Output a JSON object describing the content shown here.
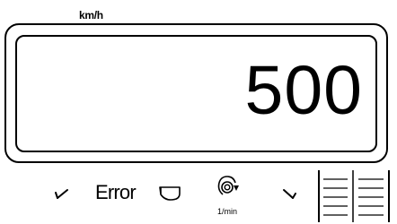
{
  "header": {
    "unit_label": "km/h"
  },
  "display": {
    "value": "500"
  },
  "controls": {
    "error_label": "Error",
    "rpm_unit": "1/min"
  },
  "icons": {
    "left_arrow": "chevron-down-left-icon",
    "funnel": "hopper-icon",
    "rotation": "rotation-icon",
    "right_arrow": "chevron-down-right-icon",
    "level": "level-bars-icon"
  },
  "colors": {
    "foreground": "#000000",
    "background": "#ffffff"
  }
}
